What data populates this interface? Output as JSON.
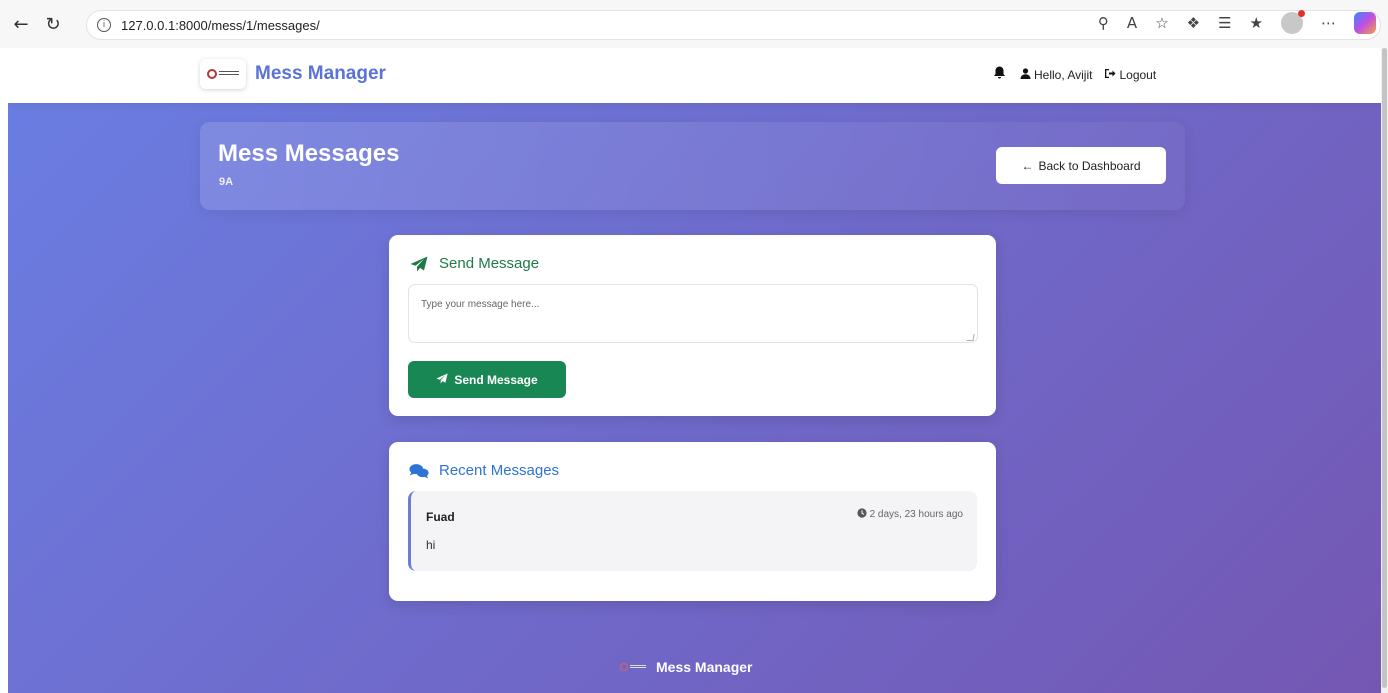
{
  "browser": {
    "url": "127.0.0.1:8000/mess/1/messages/",
    "info_symbol": "i"
  },
  "navbar": {
    "brand": "Mess Manager",
    "greeting": "Hello, Avijit",
    "logout": "Logout"
  },
  "header": {
    "title": "Mess Messages",
    "subtitle": "9A",
    "back_button": "Back to Dashboard"
  },
  "send": {
    "title": "Send Message",
    "placeholder": "Type your message here...",
    "button": "Send Message"
  },
  "recent": {
    "title": "Recent Messages",
    "messages": [
      {
        "author": "Fuad",
        "time": "2 days, 23 hours ago",
        "body": "hi"
      }
    ]
  },
  "footer": {
    "brand": "Mess Manager"
  },
  "colors": {
    "brand": "#5b72d8",
    "send_green": "#198754",
    "recent_blue": "#2f73d5",
    "gradient_start": "#6a7ee3",
    "gradient_end": "#7457b3"
  }
}
